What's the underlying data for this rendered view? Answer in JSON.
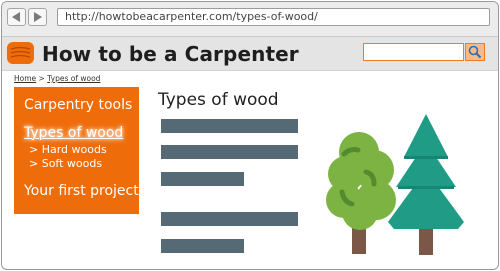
{
  "browser": {
    "url": "http://howtobeacarpenter.com/types-of-wood/",
    "back_icon": "back-arrow-icon",
    "forward_icon": "forward-arrow-icon"
  },
  "header": {
    "logo_icon": "wood-log-icon",
    "title": "How to be a Carpenter",
    "search": {
      "placeholder": "",
      "icon": "magnifier-icon"
    }
  },
  "breadcrumb": {
    "home": "Home",
    "separator": ">",
    "current": "Types of wood"
  },
  "sidebar": {
    "items": [
      {
        "label": "Carpentry tools"
      },
      {
        "label": "Types of wood",
        "active": true
      },
      {
        "label": "Your first project"
      }
    ],
    "subitems": [
      {
        "label": "> Hard woods"
      },
      {
        "label": "> Soft woods"
      }
    ]
  },
  "main": {
    "heading": "Types of wood",
    "illustration_icons": [
      "deciduous-tree-icon",
      "pine-tree-icon"
    ]
  },
  "colors": {
    "accent": "#ef6c0a",
    "text_placeholder": "#556a74",
    "leaf_green": "#7cb342",
    "pine_teal": "#1f9b86",
    "trunk": "#7b5747"
  }
}
